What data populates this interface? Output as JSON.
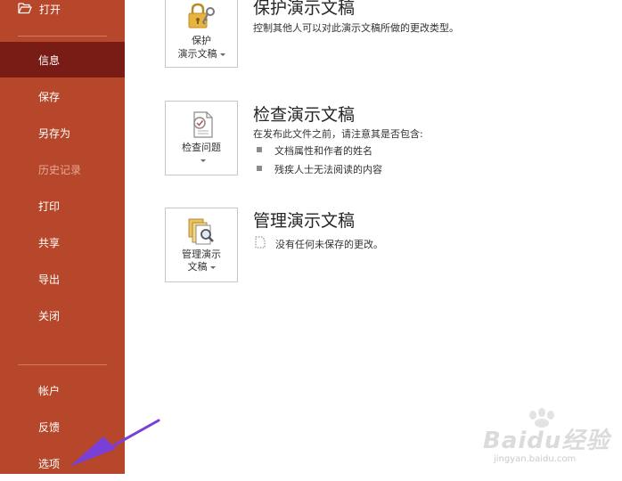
{
  "sidebar": {
    "open_label": "打开",
    "items": [
      {
        "label": "信息"
      },
      {
        "label": "保存"
      },
      {
        "label": "另存为"
      },
      {
        "label": "历史记录"
      },
      {
        "label": "打印"
      },
      {
        "label": "共享"
      },
      {
        "label": "导出"
      },
      {
        "label": "关闭"
      }
    ],
    "bottom_items": [
      {
        "label": "帐户"
      },
      {
        "label": "反馈"
      },
      {
        "label": "选项"
      }
    ],
    "selected": "信息",
    "background_color": "#b7472a",
    "selected_color": "#7a1c16"
  },
  "sections": {
    "protect": {
      "button_line1": "保护",
      "button_line2": "演示文稿",
      "title": "保护演示文稿",
      "description": "控制其他人可以对此演示文稿所做的更改类型。"
    },
    "inspect": {
      "button_label": "检查问题",
      "title": "检查演示文稿",
      "description": "在发布此文件之前，请注意其是否包含:",
      "bullets": [
        "文档属性和作者的姓名",
        "残疾人士无法阅读的内容"
      ]
    },
    "manage": {
      "button_line1": "管理演示",
      "button_line2": "文稿",
      "title": "管理演示文稿",
      "description": "没有任何未保存的更改。"
    }
  },
  "watermark": {
    "brand": "Baidu经验",
    "url": "jingyan.baidu.com"
  },
  "icons": {
    "open": "folder-open-icon",
    "protect": "lock-key-icon",
    "inspect": "document-check-icon",
    "manage": "document-search-icon",
    "no_changes": "document-dotted-icon"
  },
  "annotation": {
    "color": "#7a3fd6"
  }
}
